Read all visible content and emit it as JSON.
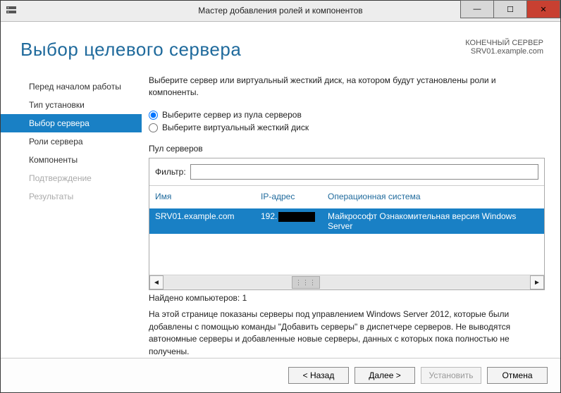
{
  "window": {
    "title": "Мастер добавления ролей и компонентов"
  },
  "header": {
    "page_title": "Выбор целевого сервера",
    "dest_label": "КОНЕЧНЫЙ СЕРВЕР",
    "dest_server": "SRV01.example.com"
  },
  "sidebar": {
    "items": [
      {
        "label": "Перед началом работы"
      },
      {
        "label": "Тип установки"
      },
      {
        "label": "Выбор сервера"
      },
      {
        "label": "Роли сервера"
      },
      {
        "label": "Компоненты"
      },
      {
        "label": "Подтверждение"
      },
      {
        "label": "Результаты"
      }
    ]
  },
  "content": {
    "description": "Выберите сервер или виртуальный жесткий диск, на котором будут установлены роли и компоненты.",
    "radio_pool": "Выберите сервер из пула серверов",
    "radio_vhd": "Выберите виртуальный жесткий диск",
    "pool_label": "Пул серверов",
    "filter_label": "Фильтр:",
    "filter_value": "",
    "columns": {
      "name": "Имя",
      "ip": "IP-адрес",
      "os": "Операционная система"
    },
    "row": {
      "name": "SRV01.example.com",
      "ip_prefix": "192.",
      "os": "Майкрософт Ознакомительная версия Windows Server"
    },
    "found": "Найдено компьютеров: 1",
    "note": "На этой странице показаны серверы под управлением Windows Server 2012, которые были добавлены с помощью команды \"Добавить серверы\" в диспетчере серверов. Не выводятся автономные серверы и добавленные новые серверы, данных с которых пока полностью не получены."
  },
  "footer": {
    "back": "< Назад",
    "next": "Далее >",
    "install": "Установить",
    "cancel": "Отмена"
  }
}
